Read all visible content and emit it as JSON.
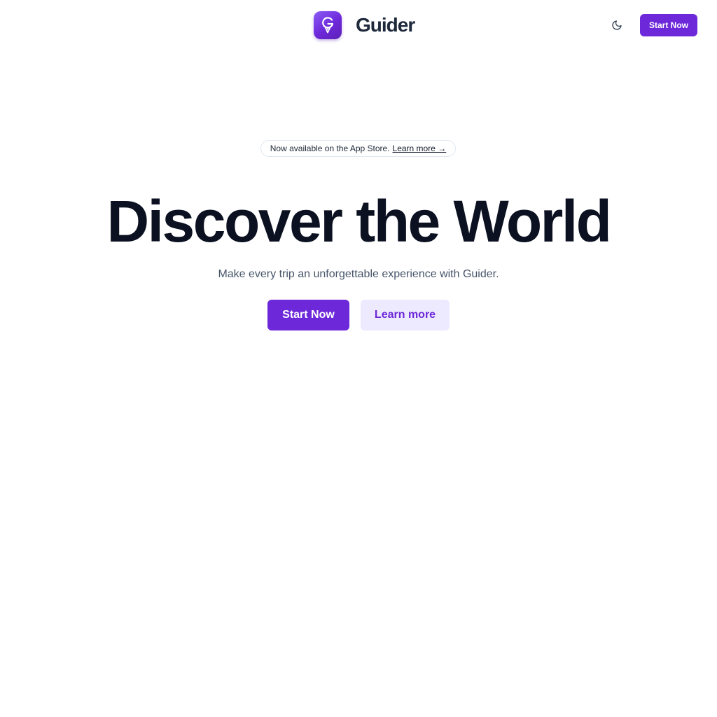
{
  "header": {
    "brand_name": "Guider",
    "logo_icon": "map-pin-g-icon",
    "theme_toggle_icon": "moon-icon",
    "start_label": "Start Now"
  },
  "announcement": {
    "text": "Now available on the App Store.",
    "link_label": "Learn more →"
  },
  "hero": {
    "title": "Discover the World",
    "subtitle": "Make every trip an unforgettable experience with Guider.",
    "primary_label": "Start Now",
    "secondary_label": "Learn more"
  },
  "colors": {
    "accent": "#6d28d9",
    "accent_soft": "#ede9fe",
    "heading": "#0b1120",
    "muted": "#475569"
  }
}
